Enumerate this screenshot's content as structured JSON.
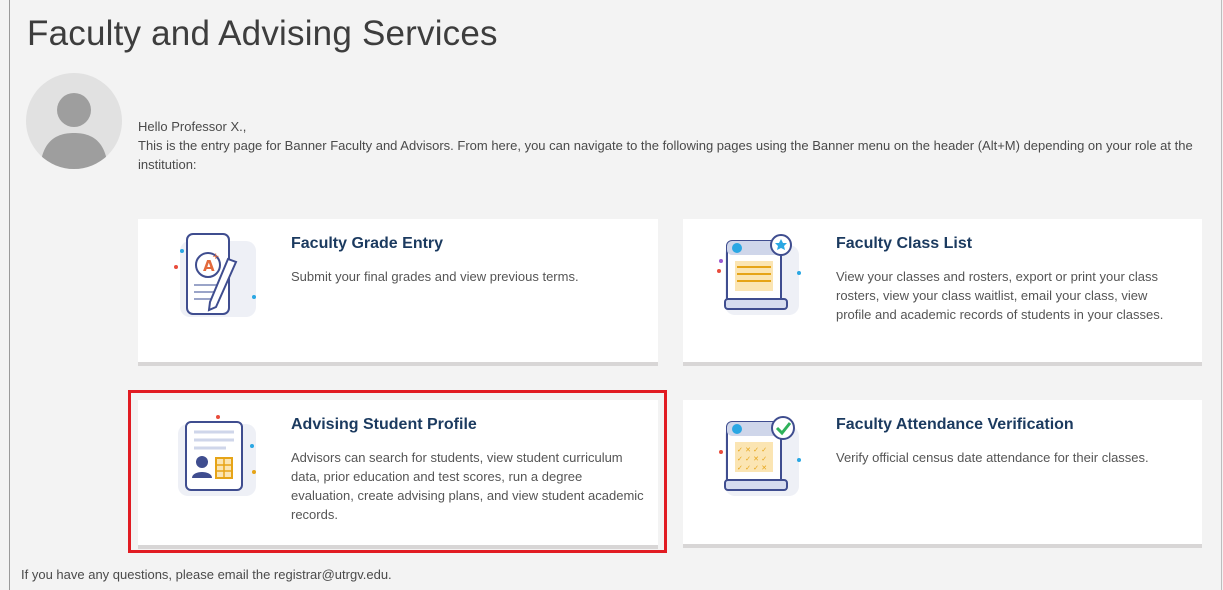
{
  "page": {
    "title": "Faculty and Advising Services"
  },
  "intro": {
    "greeting": "Hello Professor X.,",
    "text": "This is the entry page for Banner Faculty and Advisors. From here, you can navigate to the following pages using the Banner menu on the header (Alt+M) depending on your role at the institution:"
  },
  "cards": [
    {
      "title": "Faculty Grade Entry",
      "description": "Submit your final grades and view previous terms.",
      "icon": "grade-entry-icon"
    },
    {
      "title": "Faculty Class List",
      "description": "View your classes and rosters, export or print your class rosters, view your class waitlist, email your class, view profile and academic records of students in your classes.",
      "icon": "class-list-icon"
    },
    {
      "title": "Advising Student Profile",
      "description": "Advisors can search for students, view student curriculum data, prior education and test scores, run a degree evaluation, create advising plans, and view student academic records.",
      "icon": "student-profile-icon"
    },
    {
      "title": "Faculty Attendance Verification",
      "description": "Verify official census date attendance for their classes.",
      "icon": "attendance-verification-icon"
    }
  ],
  "footer": {
    "text": "If you have any questions, please email the registrar@utrgv.edu."
  }
}
